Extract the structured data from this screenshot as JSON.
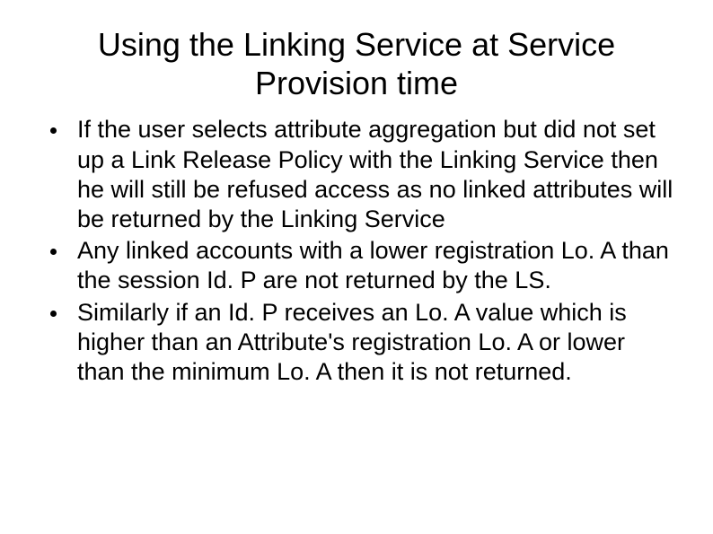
{
  "title": "Using the Linking Service at Service Provision time",
  "bullets": [
    "If the user selects attribute aggregation but did not set up a Link Release Policy with the Linking Service then he will still be refused access as no linked attributes will be returned by the Linking Service",
    " Any linked accounts with a lower registration Lo. A than the session Id. P are not returned by the LS.",
    "Similarly if an Id. P receives an Lo. A value which is higher than an Attribute's registration Lo. A or lower than the minimum Lo. A then it is not returned."
  ]
}
